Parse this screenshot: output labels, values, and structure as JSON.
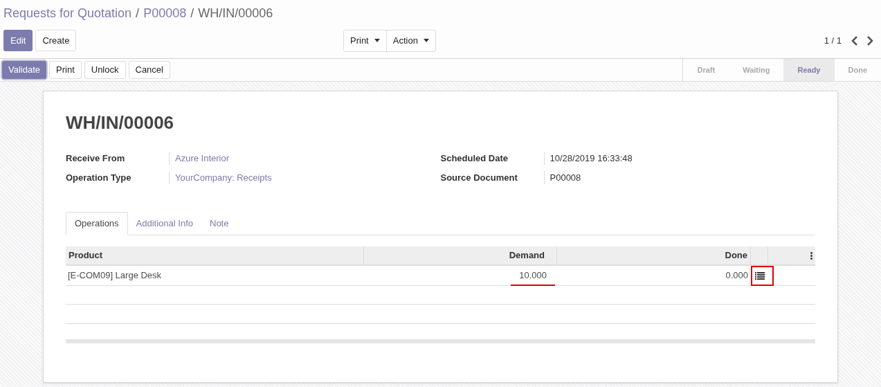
{
  "breadcrumbs": [
    {
      "label": "Requests for Quotation",
      "link": true
    },
    {
      "separator": "/",
      "label": "P00008",
      "link": true
    },
    {
      "separator": "/",
      "label": "WH/IN/00006",
      "link": false
    }
  ],
  "control_buttons": [
    {
      "label": "Edit",
      "primary": true
    },
    {
      "label": "Create",
      "primary": false
    }
  ],
  "dropdowns": [
    "Print",
    "Action"
  ],
  "pager": "1 / 1",
  "action_buttons": [
    {
      "label": "Validate",
      "primary": true
    },
    {
      "label": "Print",
      "primary": false
    },
    {
      "label": "Unlock",
      "primary": false
    },
    {
      "label": "Cancel",
      "primary": false
    }
  ],
  "statuses": [
    {
      "label": "Draft",
      "selected": false
    },
    {
      "label": "Waiting",
      "selected": false
    },
    {
      "label": "Ready",
      "selected": true
    },
    {
      "label": "Done",
      "selected": false
    }
  ],
  "record_title": "WH/IN/00006",
  "fields_left": [
    {
      "label": "Receive From",
      "value": "Azure Interior",
      "link": true
    },
    {
      "label": "Operation Type",
      "value": "YourCompany: Receipts",
      "link": true
    }
  ],
  "fields_right": [
    {
      "label": "Scheduled Date",
      "value": "10/28/2019 16:33:48",
      "link": false
    },
    {
      "label": "Source Document",
      "value": "P00008",
      "link": false
    }
  ],
  "tabs": [
    {
      "label": "Operations",
      "selected": true
    },
    {
      "label": "Additional Info",
      "selected": false
    },
    {
      "label": "Note",
      "selected": false
    }
  ],
  "table": {
    "columns": [
      "Product",
      "Demand",
      "Done"
    ],
    "rows": [
      {
        "product": "[E-COM09] Large Desk",
        "demand": "10.000",
        "done": "0.000",
        "demand_underlined": true,
        "detail_highlighted": true
      }
    ]
  }
}
